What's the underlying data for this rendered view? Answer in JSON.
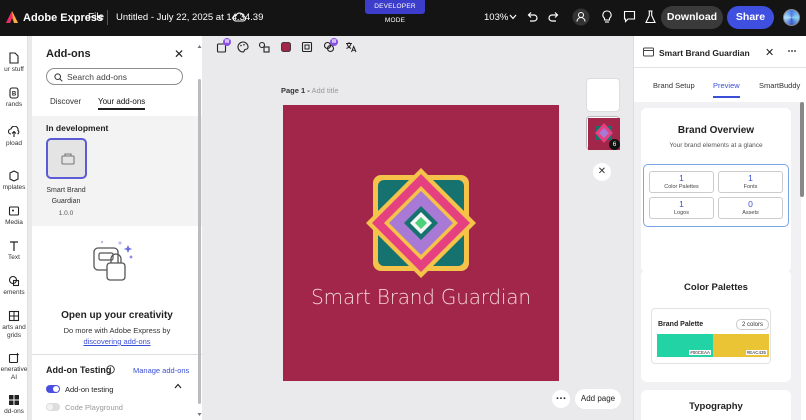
{
  "topbar": {
    "app_name": "Adobe Express",
    "file_menu": "File",
    "doc_title": "Untitled - July 22, 2025 at 14.34.39",
    "dev_mode": "DEVELOPER MODE",
    "zoom": "103%",
    "download": "Download",
    "share": "Share"
  },
  "rail": {
    "items": [
      {
        "label": "ur stuff",
        "icon": "file-icon"
      },
      {
        "label": "rands",
        "icon": "brand-icon"
      },
      {
        "label": "pload",
        "icon": "upload-icon"
      },
      {
        "label": "mplates",
        "icon": "templates-icon"
      },
      {
        "label": "Media",
        "icon": "media-icon"
      },
      {
        "label": "Text",
        "icon": "text-icon"
      },
      {
        "label": "ements",
        "icon": "elements-icon"
      },
      {
        "label": "arts and",
        "label2": "grids",
        "icon": "charts-icon"
      },
      {
        "label": "enerative",
        "label2": "AI",
        "icon": "genai-icon"
      },
      {
        "label": "dd-ons",
        "icon": "addons-icon"
      }
    ]
  },
  "addons": {
    "title": "Add-ons",
    "search_placeholder": "Search add-ons",
    "tabs": [
      "Discover",
      "Your add-ons"
    ],
    "dev_title": "In development",
    "addon_name_line1": "Smart Brand",
    "addon_name_line2": "Guardian",
    "addon_version": "1.0.0",
    "creativity_title": "Open up your creativity",
    "creativity_sub": "Do more with Adobe Express by",
    "creativity_link": "discovering add-ons",
    "testing_title": "Add-on Testing",
    "manage_link": "Manage add-ons",
    "toggle_testing": "Add-on testing",
    "toggle_testing_on": true,
    "toggle_playground": "Code Playground",
    "toggle_playground_on": false
  },
  "canvas": {
    "page_label": "Page 1 -",
    "add_title": "Add title",
    "design_text": "Smart Brand Guardian",
    "thumb_count": "6",
    "add_page": "Add page",
    "colors": {
      "background": "#a2264a",
      "outer_square": "#f5c34a",
      "teal": "#16726e",
      "pink": "#e5407f",
      "purple": "#a979d6"
    }
  },
  "right_panel": {
    "title": "Smart Brand Guardian",
    "tabs": [
      "Brand Setup",
      "Preview",
      "SmartBuddy"
    ],
    "active_tab": "Preview",
    "overview_title": "Brand Overview",
    "overview_sub": "Your brand elements at a glance",
    "stats": [
      {
        "value": "1",
        "label": "Color Palettes"
      },
      {
        "value": "1",
        "label": "Fonts"
      },
      {
        "value": "1",
        "label": "Logos"
      },
      {
        "value": "0",
        "label": "Assets"
      }
    ],
    "palettes_title": "Color Palettes",
    "palette_name": "Brand Palette",
    "palette_count": "2 colors",
    "palette_colors": [
      {
        "hex": "#00CEAA",
        "color": "#22d3a6"
      },
      {
        "hex": "#EAC435",
        "color": "#eac435"
      }
    ],
    "typography_title": "Typography"
  }
}
